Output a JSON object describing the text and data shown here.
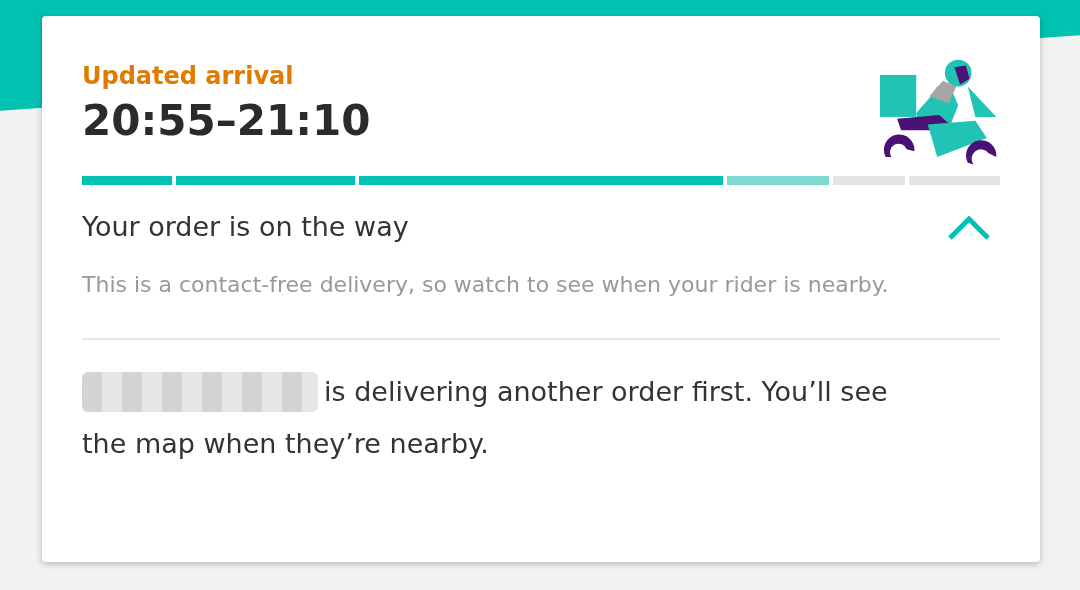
{
  "arrival": {
    "label": "Updated arrival",
    "time": "20:55–21:10"
  },
  "progress": [
    {
      "kind": "done"
    },
    {
      "kind": "done"
    },
    {
      "kind": "done"
    },
    {
      "kind": "current"
    },
    {
      "kind": "pending"
    },
    {
      "kind": "pending"
    }
  ],
  "status": {
    "title": "Your order is on the way",
    "expanded": true,
    "detail": "This is a contact-free delivery, so watch to see when your rider is nearby."
  },
  "rider_message": {
    "line_1": "is delivering another order first. You’ll see",
    "line_2": "the map when they’re nearby."
  }
}
